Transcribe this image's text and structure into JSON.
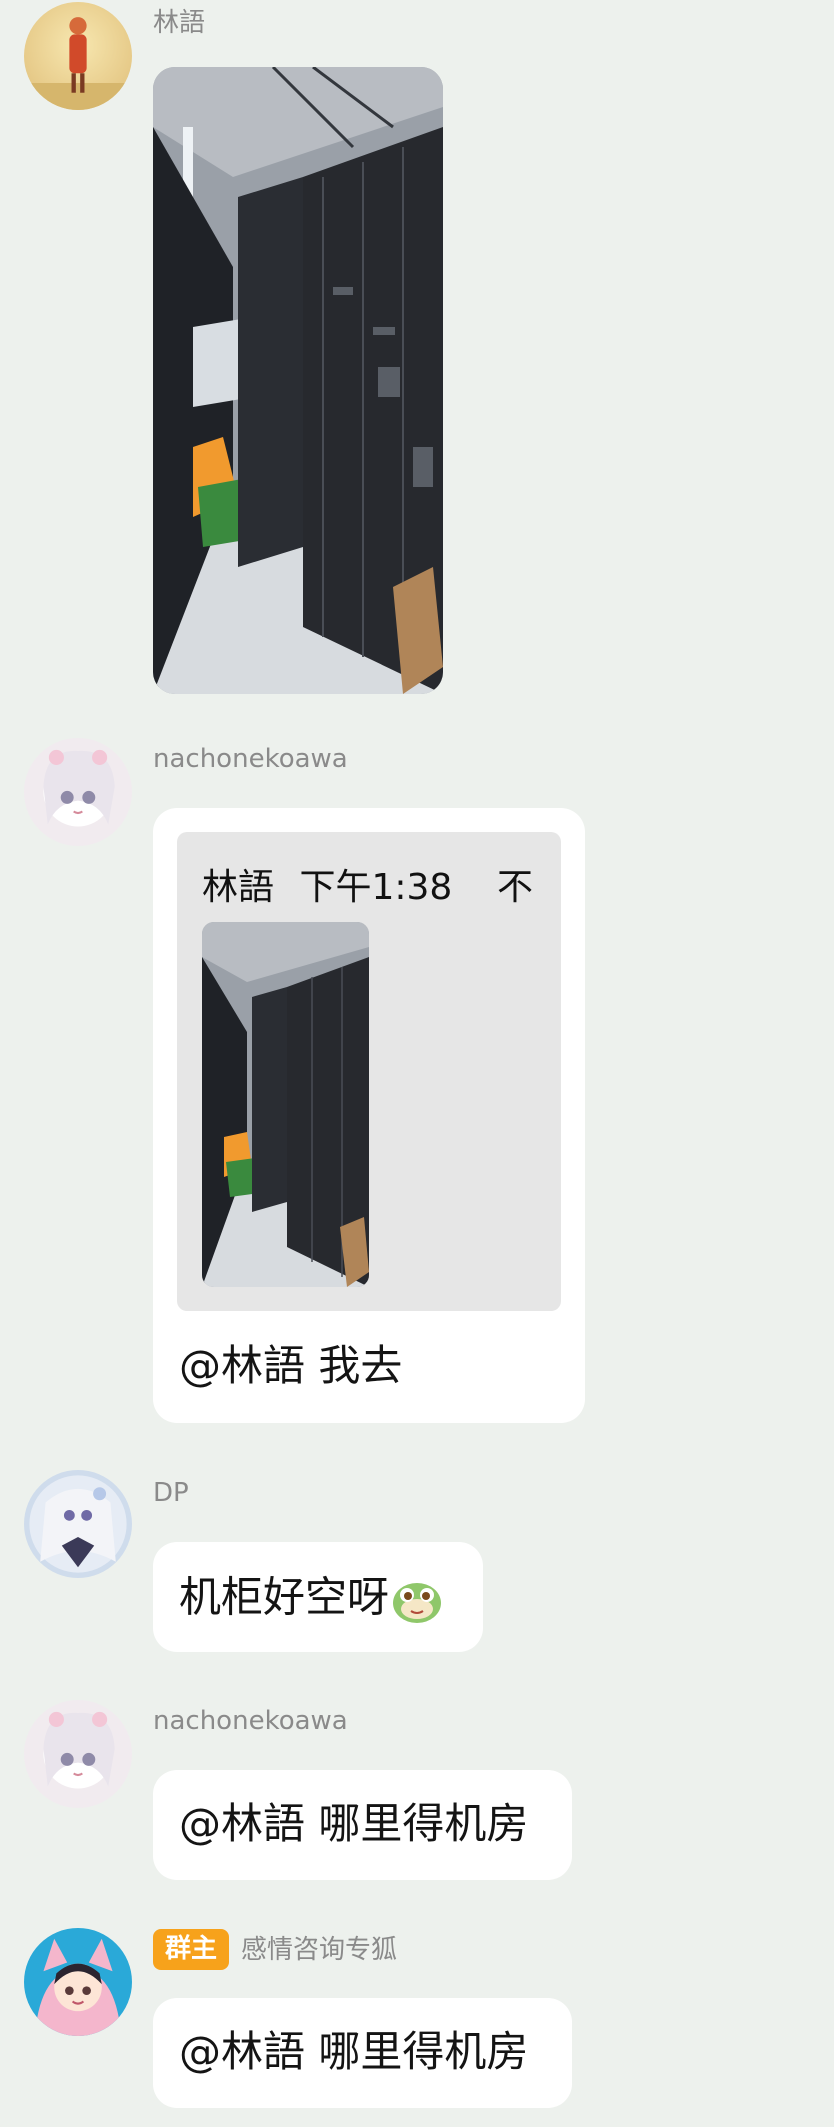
{
  "messages": [
    {
      "sender": "林語",
      "type": "image",
      "image_alt": "server-room-photo"
    },
    {
      "sender": "nachonekoawa",
      "type": "quote-reply",
      "quote": {
        "author": "林語",
        "time": "下午1:38",
        "close_glyph": "不"
      },
      "text": "@林語 我去"
    },
    {
      "sender": "DP",
      "type": "text",
      "text": "机柜好空呀",
      "emoji": "frog-emoji"
    },
    {
      "sender": "nachonekoawa",
      "type": "text",
      "text": "@林語 哪里得机房"
    },
    {
      "sender": "感情咨询专狐",
      "badge": "群主",
      "type": "text",
      "text": "@林語 哪里得机房"
    }
  ],
  "colors": {
    "background": "#edf1ed",
    "bubble": "#ffffff",
    "quote_bg": "#e6e6e6",
    "owner_badge": "#f7a21b",
    "sender_name": "#8a8a8a"
  }
}
